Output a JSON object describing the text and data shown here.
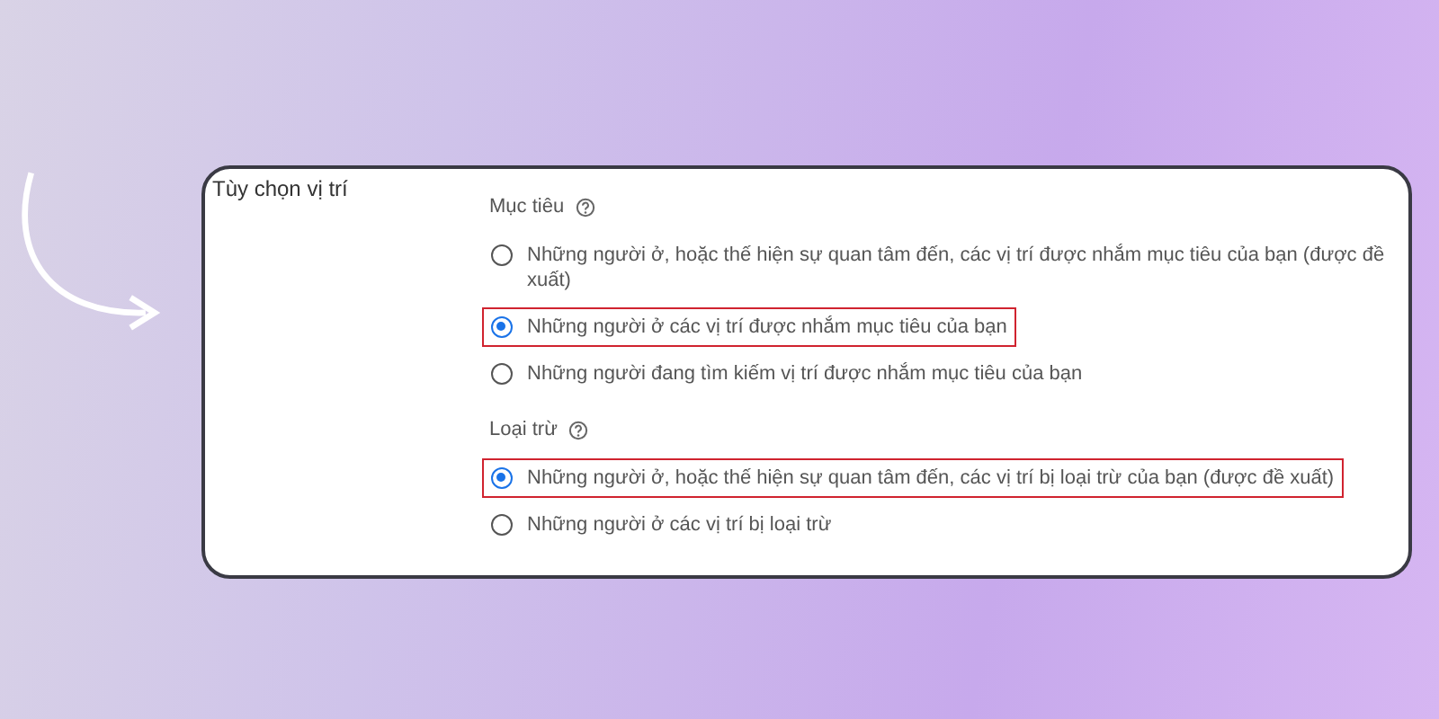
{
  "panel": {
    "title": "Tùy chọn vị trí",
    "groups": [
      {
        "heading": "Mục tiêu",
        "options": [
          {
            "label": "Những người ở, hoặc thế hiện sự quan tâm đến, các vị trí được nhắm mục tiêu của bạn (được đề xuất)",
            "selected": false,
            "highlighted": false
          },
          {
            "label": "Những người ở các vị trí được nhắm mục tiêu của bạn",
            "selected": true,
            "highlighted": true
          },
          {
            "label": "Những người đang tìm kiếm vị trí được nhắm mục tiêu của bạn",
            "selected": false,
            "highlighted": false
          }
        ]
      },
      {
        "heading": "Loại trừ",
        "options": [
          {
            "label": "Những người ở, hoặc thế hiện sự quan tâm đến, các vị trí bị loại trừ của bạn (được đề xuất)",
            "selected": true,
            "highlighted": true
          },
          {
            "label": "Những người ở các vị trí bị loại trừ",
            "selected": false,
            "highlighted": false
          }
        ]
      }
    ]
  }
}
